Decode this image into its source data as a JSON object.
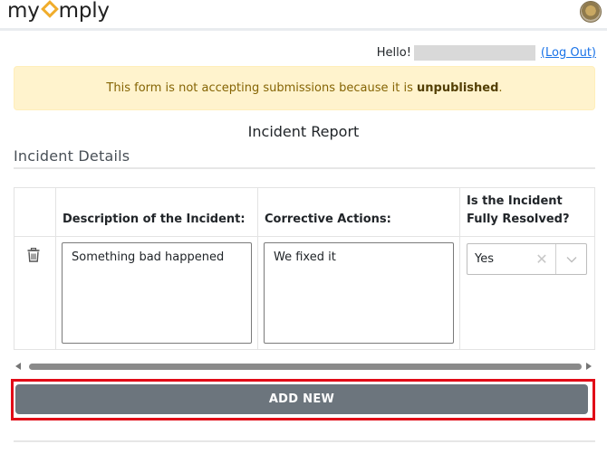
{
  "app": {
    "logo_pre": "my",
    "logo_post": "mply",
    "accent_color": "#f0ad2c"
  },
  "header": {
    "greeting": "Hello!",
    "logout_label": "(Log Out)"
  },
  "alert": {
    "text_before": "This form is not accepting submissions because it is ",
    "text_bold": "unpublished",
    "text_after": ".",
    "background": "#fff3cd"
  },
  "form": {
    "title": "Incident Report",
    "section_title": "Incident Details"
  },
  "table": {
    "columns": [
      "Description of the Incident:",
      "Corrective Actions:",
      "Is the Incident Fully Resolved?"
    ],
    "rows": [
      {
        "description": "Something bad happened",
        "corrective_actions": "We fixed it",
        "resolved": "Yes",
        "delete_icon": "trash-icon"
      }
    ]
  },
  "actions": {
    "add_new_label": "ADD NEW",
    "highlight_color": "#e10b17"
  }
}
